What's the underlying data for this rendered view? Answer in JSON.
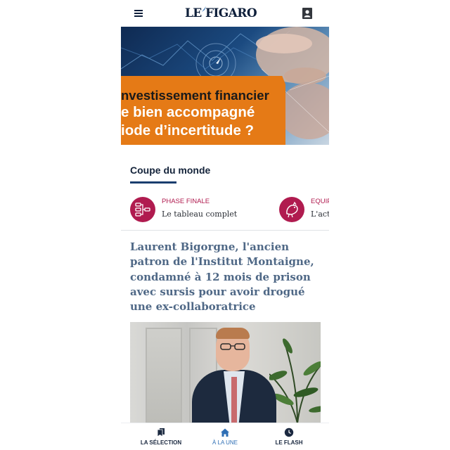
{
  "header": {
    "logo": "LE FIGARO",
    "menu_icon": "hamburger-menu-icon",
    "account_icon": "user-account-icon"
  },
  "ad_banner": {
    "line1": "nvestissement financier",
    "line2": "e bien accompagné",
    "line3": "iode d’incertitude ?",
    "panel_color": "#e57a16"
  },
  "section": {
    "title": "Coupe du monde",
    "accent_color": "#1a3e6e"
  },
  "carousel": {
    "items": [
      {
        "kicker": "PHASE FINALE",
        "text": "Le tableau complet",
        "icon": "bracket-icon"
      },
      {
        "kicker": "EQUIP",
        "text": "L'actu",
        "icon": "rooster-icon"
      }
    ],
    "kicker_color": "#b01b4f"
  },
  "article": {
    "headline": "Laurent Bigorgne, l'ancien patron de l'Institut Montaigne, condamné à 12 mois de prison avec sursis pour avoir drogué une ex-collaboratrice",
    "headline_color": "#4f6886"
  },
  "bottom_nav": {
    "items": [
      {
        "label": "LA SÉLECTION",
        "icon": "bookmark-icon",
        "active": false
      },
      {
        "label": "À LA UNE",
        "icon": "home-icon",
        "active": true
      },
      {
        "label": "LE FLASH",
        "icon": "clock-icon",
        "active": false
      }
    ],
    "active_color": "#2f6fb5"
  }
}
